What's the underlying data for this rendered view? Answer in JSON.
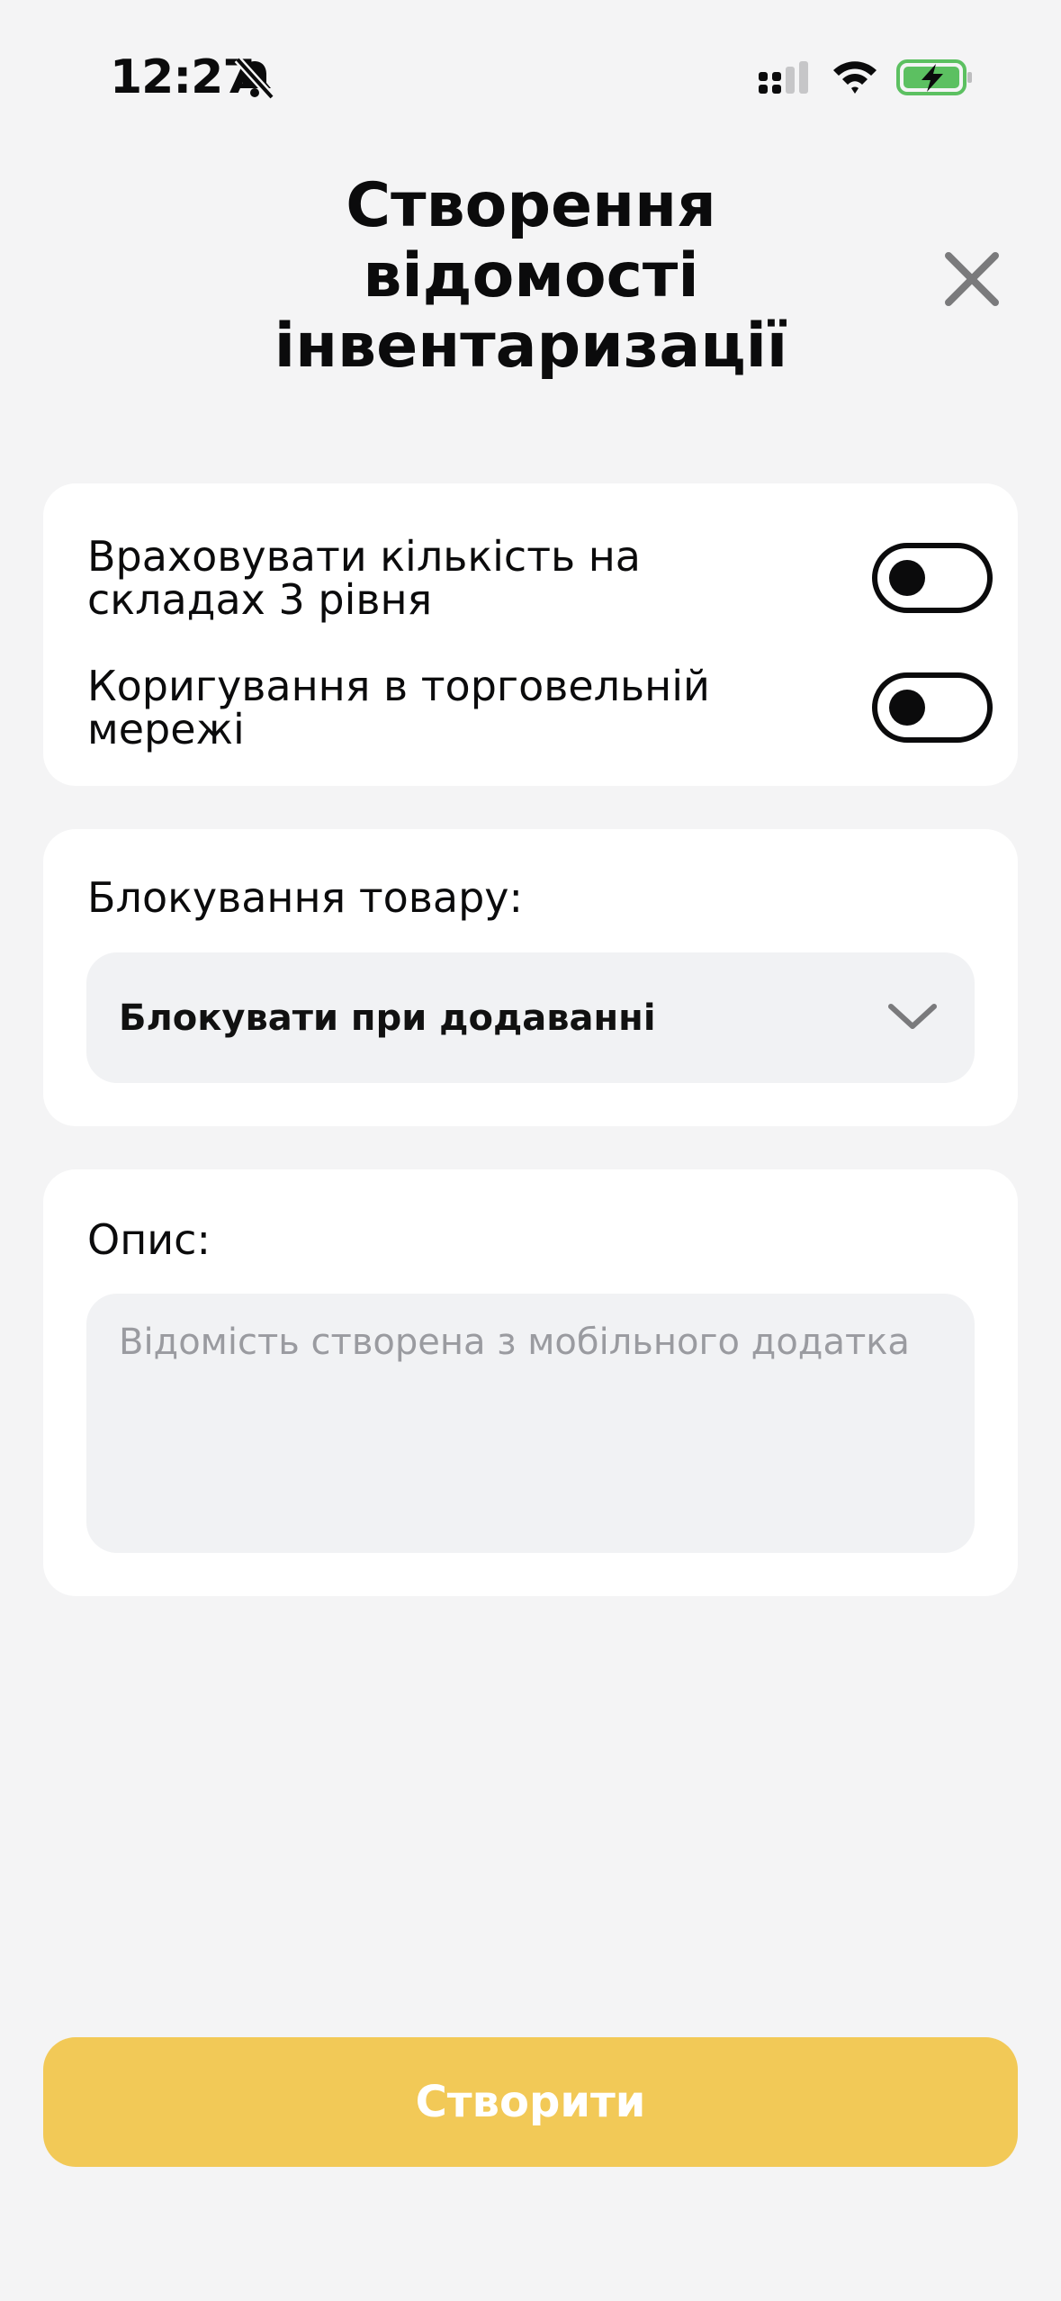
{
  "status_bar": {
    "time": "12:27",
    "icons": [
      "bell-slash-icon",
      "cellular-signal-icon",
      "wifi-icon",
      "battery-charging-icon"
    ],
    "battery_color": "#5cc061"
  },
  "header": {
    "title": "Створення\nвідомості\nінвентаризації",
    "close_icon": "close-icon"
  },
  "options": {
    "toggles": [
      {
        "label": "Враховувати кількість на\nскладах 3 рівня",
        "enabled": false
      },
      {
        "label": "Коригування в торговельній\nмережі",
        "enabled": false
      }
    ]
  },
  "blocking": {
    "label": "Блокування товару:",
    "selected": "Блокувати при додаванні",
    "icon": "chevron-down-icon"
  },
  "description": {
    "label": "Опис:",
    "value": "",
    "placeholder": "Відомість створена з мобільного додатка"
  },
  "actions": {
    "create_label": "Створити",
    "create_color": "#f2c957"
  }
}
